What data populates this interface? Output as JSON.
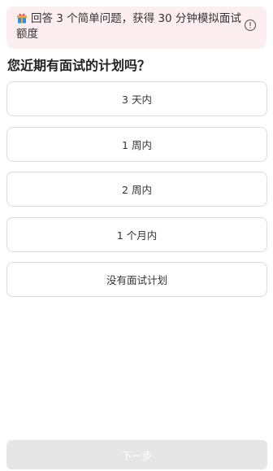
{
  "banner": {
    "icon": "gift-icon",
    "text": "回答 3 个简单问题，获得 30 分钟模拟面试额度",
    "info_icon": "info-circle-icon"
  },
  "question": {
    "title": "您近期有面试的计划吗？"
  },
  "options": [
    {
      "label": "3 天内"
    },
    {
      "label": "1 周内"
    },
    {
      "label": "2 周内"
    },
    {
      "label": "1 个月内"
    },
    {
      "label": "没有面试计划"
    }
  ],
  "footer": {
    "next_label": "下一步",
    "next_enabled": false
  },
  "colors": {
    "banner_bg": "#fdeff0",
    "option_border": "#dcdcdc",
    "disabled_button_bg": "#e6e6e6"
  }
}
